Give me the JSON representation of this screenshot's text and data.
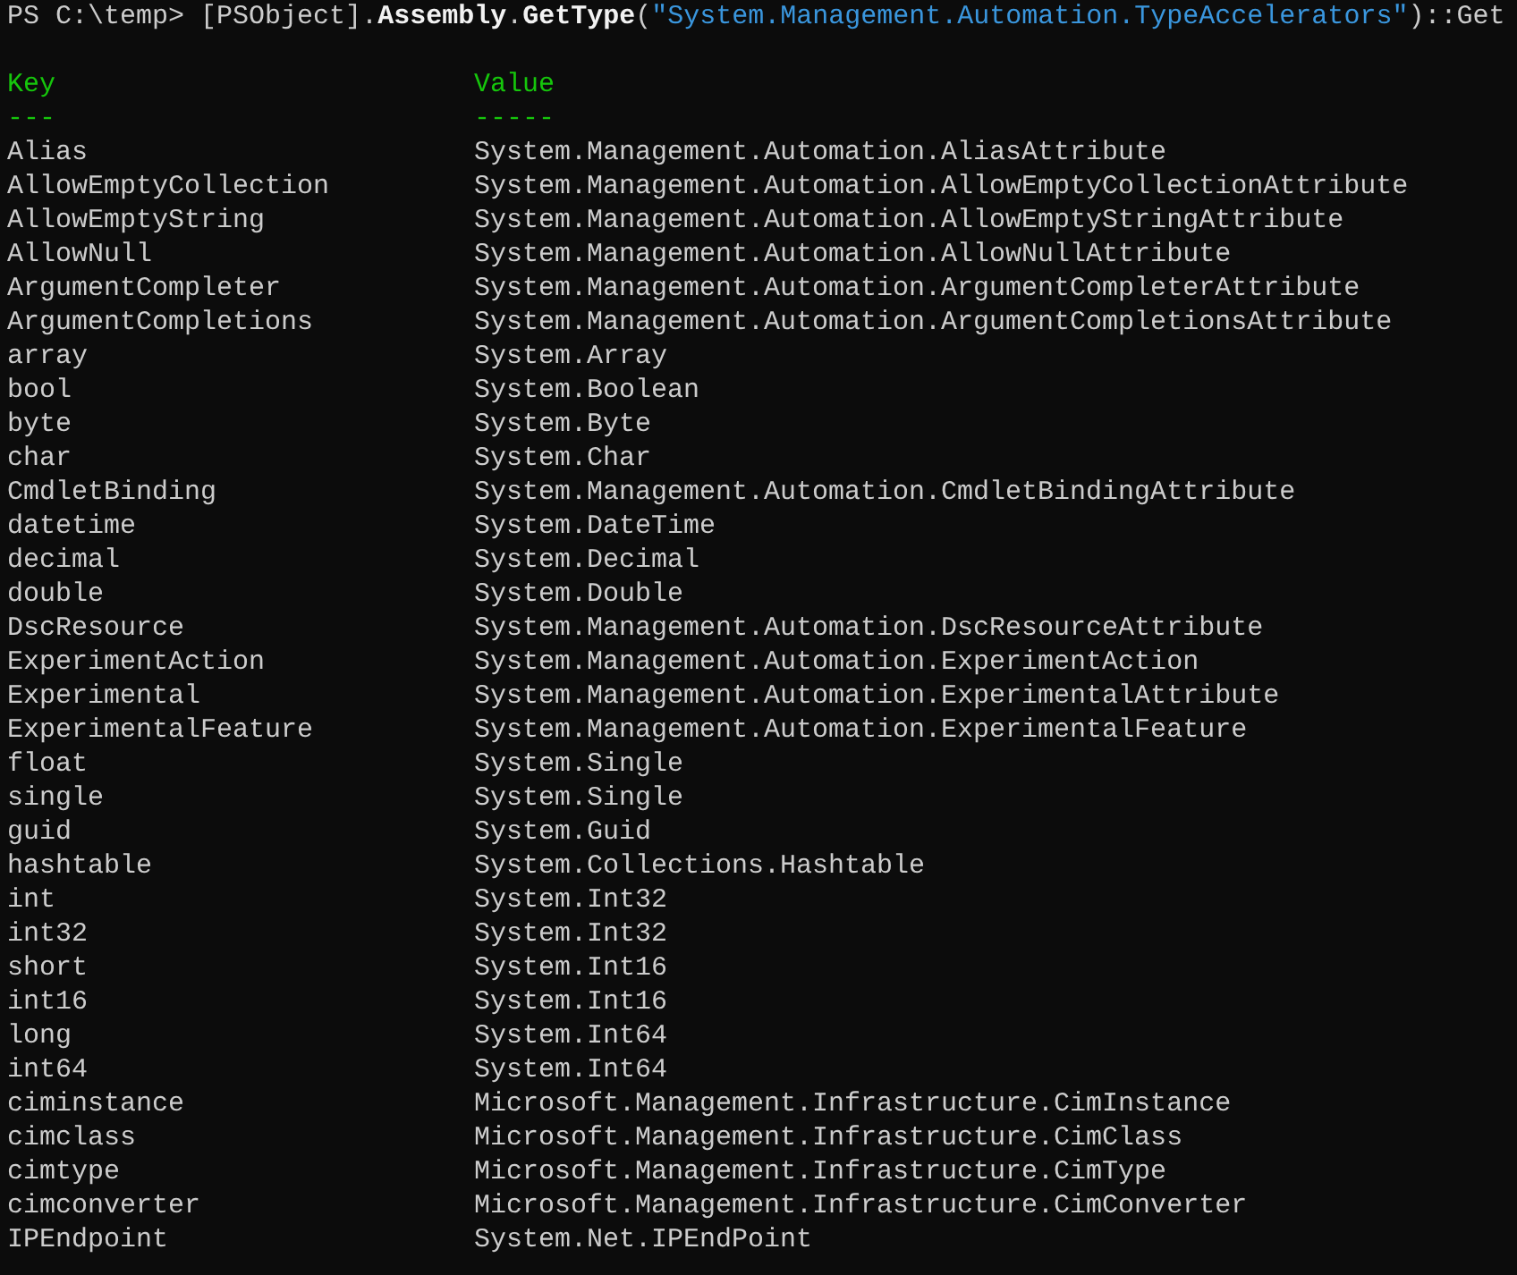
{
  "command": [
    {
      "kind": "prompt",
      "text": "PS C:\\temp> "
    },
    {
      "kind": "plain",
      "text": "[PSObject]."
    },
    {
      "kind": "member",
      "text": "Assembly"
    },
    {
      "kind": "plain",
      "text": "."
    },
    {
      "kind": "member",
      "text": "GetType"
    },
    {
      "kind": "plain",
      "text": "("
    },
    {
      "kind": "string",
      "text": "\"System.Management.Automation.TypeAccelerators\""
    },
    {
      "kind": "plain",
      "text": ")::Get"
    }
  ],
  "table": {
    "columns": [
      {
        "label": "Key",
        "rule": "---"
      },
      {
        "label": "Value",
        "rule": "-----"
      }
    ],
    "rows": [
      [
        "Alias",
        "System.Management.Automation.AliasAttribute"
      ],
      [
        "AllowEmptyCollection",
        "System.Management.Automation.AllowEmptyCollectionAttribute"
      ],
      [
        "AllowEmptyString",
        "System.Management.Automation.AllowEmptyStringAttribute"
      ],
      [
        "AllowNull",
        "System.Management.Automation.AllowNullAttribute"
      ],
      [
        "ArgumentCompleter",
        "System.Management.Automation.ArgumentCompleterAttribute"
      ],
      [
        "ArgumentCompletions",
        "System.Management.Automation.ArgumentCompletionsAttribute"
      ],
      [
        "array",
        "System.Array"
      ],
      [
        "bool",
        "System.Boolean"
      ],
      [
        "byte",
        "System.Byte"
      ],
      [
        "char",
        "System.Char"
      ],
      [
        "CmdletBinding",
        "System.Management.Automation.CmdletBindingAttribute"
      ],
      [
        "datetime",
        "System.DateTime"
      ],
      [
        "decimal",
        "System.Decimal"
      ],
      [
        "double",
        "System.Double"
      ],
      [
        "DscResource",
        "System.Management.Automation.DscResourceAttribute"
      ],
      [
        "ExperimentAction",
        "System.Management.Automation.ExperimentAction"
      ],
      [
        "Experimental",
        "System.Management.Automation.ExperimentalAttribute"
      ],
      [
        "ExperimentalFeature",
        "System.Management.Automation.ExperimentalFeature"
      ],
      [
        "float",
        "System.Single"
      ],
      [
        "single",
        "System.Single"
      ],
      [
        "guid",
        "System.Guid"
      ],
      [
        "hashtable",
        "System.Collections.Hashtable"
      ],
      [
        "int",
        "System.Int32"
      ],
      [
        "int32",
        "System.Int32"
      ],
      [
        "short",
        "System.Int16"
      ],
      [
        "int16",
        "System.Int16"
      ],
      [
        "long",
        "System.Int64"
      ],
      [
        "int64",
        "System.Int64"
      ],
      [
        "ciminstance",
        "Microsoft.Management.Infrastructure.CimInstance"
      ],
      [
        "cimclass",
        "Microsoft.Management.Infrastructure.CimClass"
      ],
      [
        "cimtype",
        "Microsoft.Management.Infrastructure.CimType"
      ],
      [
        "cimconverter",
        "Microsoft.Management.Infrastructure.CimConverter"
      ],
      [
        "IPEndpoint",
        "System.Net.IPEndPoint"
      ]
    ]
  }
}
